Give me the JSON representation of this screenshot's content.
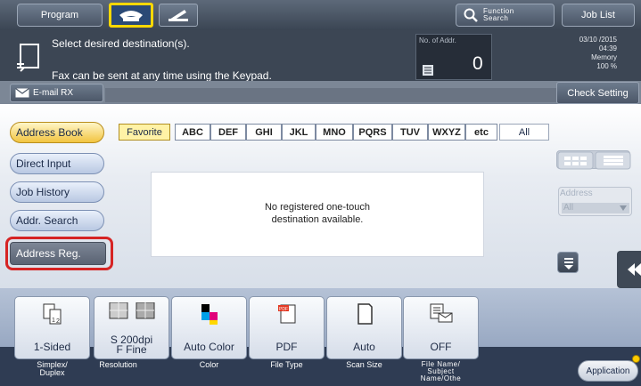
{
  "topbar": {
    "program": "Program",
    "function_search_line1": "Function",
    "function_search_line2": "Search",
    "job_list": "Job List",
    "fax_tab_icon": "phone-handset-icon",
    "phone_tab_icon": "phone-line-icon"
  },
  "message": {
    "line1": "Select desired destination(s).",
    "line2": "Fax can be sent at any time using the Keypad.",
    "addr_label": "No. of Addr.",
    "addr_count": "0",
    "date": "03/10 /2015",
    "time": "04:39",
    "memory_label": "Memory",
    "memory_value": "100 %"
  },
  "bar2": {
    "email_rx": "E-mail RX",
    "check_setting": "Check Setting"
  },
  "sidebar": {
    "items": [
      {
        "label": "Address Book"
      },
      {
        "label": "Direct Input"
      },
      {
        "label": "Job History"
      },
      {
        "label": "Addr. Search"
      },
      {
        "label": "Address Reg."
      }
    ]
  },
  "index_tabs": [
    "Favorite",
    "ABC",
    "DEF",
    "GHI",
    "JKL",
    "MNO",
    "PQRS",
    "TUV",
    "WXYZ",
    "etc",
    "All"
  ],
  "notice": {
    "line1": "No registered one-touch",
    "line2": "destination available."
  },
  "filter": {
    "label": "Address",
    "value": "All"
  },
  "settings": [
    {
      "value": "1-Sided",
      "label1": "Simplex/",
      "label2": "Duplex",
      "icon": "simplex-icon"
    },
    {
      "value": "S 200dpi",
      "value2": "F Fine",
      "label1": "Resolution",
      "label2": "",
      "icon": "resolution-icon"
    },
    {
      "value": "Auto Color",
      "label1": "Color",
      "label2": "",
      "icon": "color-icon"
    },
    {
      "value": "PDF",
      "label1": "File Type",
      "label2": "",
      "icon": "pdf-icon"
    },
    {
      "value": "Auto",
      "label1": "Scan Size",
      "label2": "",
      "icon": "page-icon"
    },
    {
      "value": "OFF",
      "label1": "File Name/",
      "label2": "Subject",
      "label3": "Name/Othe",
      "icon": "email-list-icon"
    }
  ],
  "application": "Application"
}
